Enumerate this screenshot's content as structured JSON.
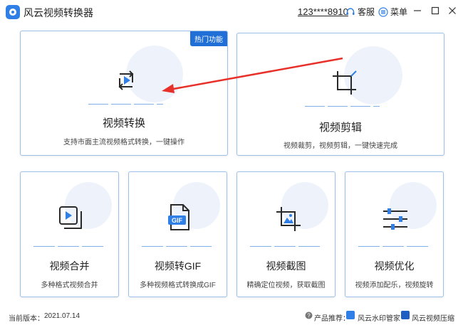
{
  "app": {
    "title": "风云视频转换器",
    "account": "123****8910",
    "service_label": "客服",
    "menu_label": "菜单"
  },
  "cards": {
    "convert": {
      "title": "视频转换",
      "desc": "支持市面主流视频格式转换，一键操作",
      "badge": "热门功能"
    },
    "edit": {
      "title": "视频剪辑",
      "desc": "视频裁剪，视频剪辑，一键快速完成"
    },
    "merge": {
      "title": "视频合并",
      "desc": "多种格式视频合并"
    },
    "gif": {
      "title": "视频转GIF",
      "desc": "多种视频格式转换成GIF",
      "icon_text": "GIF"
    },
    "screenshot": {
      "title": "视频截图",
      "desc": "精确定位视频，获取截图"
    },
    "optimize": {
      "title": "视频优化",
      "desc": "视频添加配乐，视频旋转"
    }
  },
  "footer": {
    "version_label": "当前版本：",
    "version": "2021.07.14",
    "recommend_label": "产品推荐：",
    "product1": "风云水印管家",
    "product2": "风云视频压缩"
  },
  "colors": {
    "accent": "#1f6fd6",
    "arrow": "#e8302a",
    "card_border": "#9cc0ea"
  }
}
